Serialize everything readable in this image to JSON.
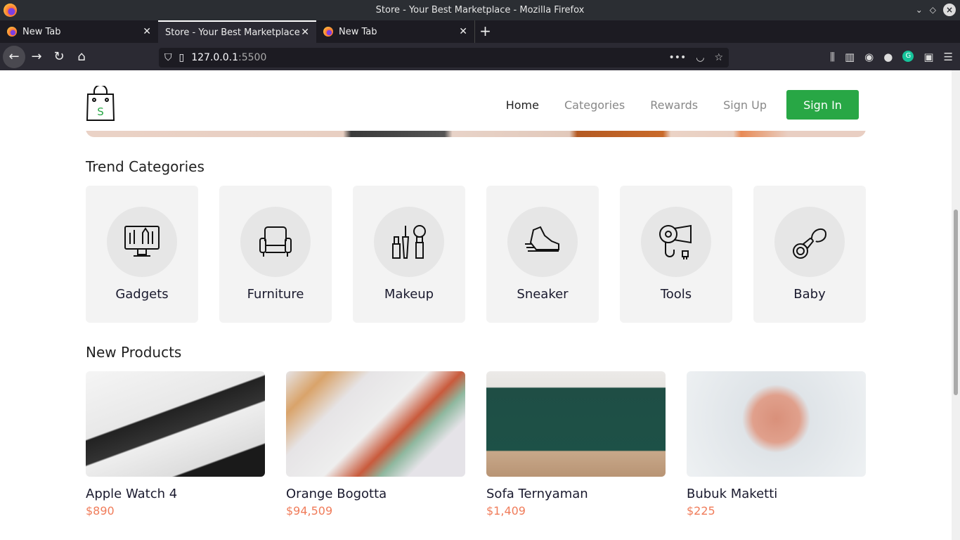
{
  "window": {
    "title": "Store - Your Best Marketplace - Mozilla Firefox"
  },
  "tabs": [
    {
      "label": "New Tab"
    },
    {
      "label": "Store - Your Best Marketplace"
    },
    {
      "label": "New Tab"
    }
  ],
  "url": {
    "host": "127.0.0.1",
    "port": ":5500"
  },
  "header": {
    "logo_letter": "S",
    "nav": [
      "Home",
      "Categories",
      "Rewards",
      "Sign Up"
    ],
    "signin": "Sign In"
  },
  "sections": {
    "categories": "Trend Categories",
    "products": "New Products"
  },
  "categories": [
    {
      "label": "Gadgets",
      "icon": "monitor-icon"
    },
    {
      "label": "Furniture",
      "icon": "armchair-icon"
    },
    {
      "label": "Makeup",
      "icon": "makeup-icon"
    },
    {
      "label": "Sneaker",
      "icon": "sneaker-icon"
    },
    {
      "label": "Tools",
      "icon": "hairdryer-icon"
    },
    {
      "label": "Baby",
      "icon": "pacifier-icon"
    }
  ],
  "products": [
    {
      "name": "Apple Watch 4",
      "price": "$890"
    },
    {
      "name": "Orange Bogotta",
      "price": "$94,509"
    },
    {
      "name": "Sofa Ternyaman",
      "price": "$1,409"
    },
    {
      "name": "Bubuk Maketti",
      "price": "$225"
    }
  ],
  "colors": {
    "accent": "#28a745",
    "price": "#f07c5a"
  }
}
